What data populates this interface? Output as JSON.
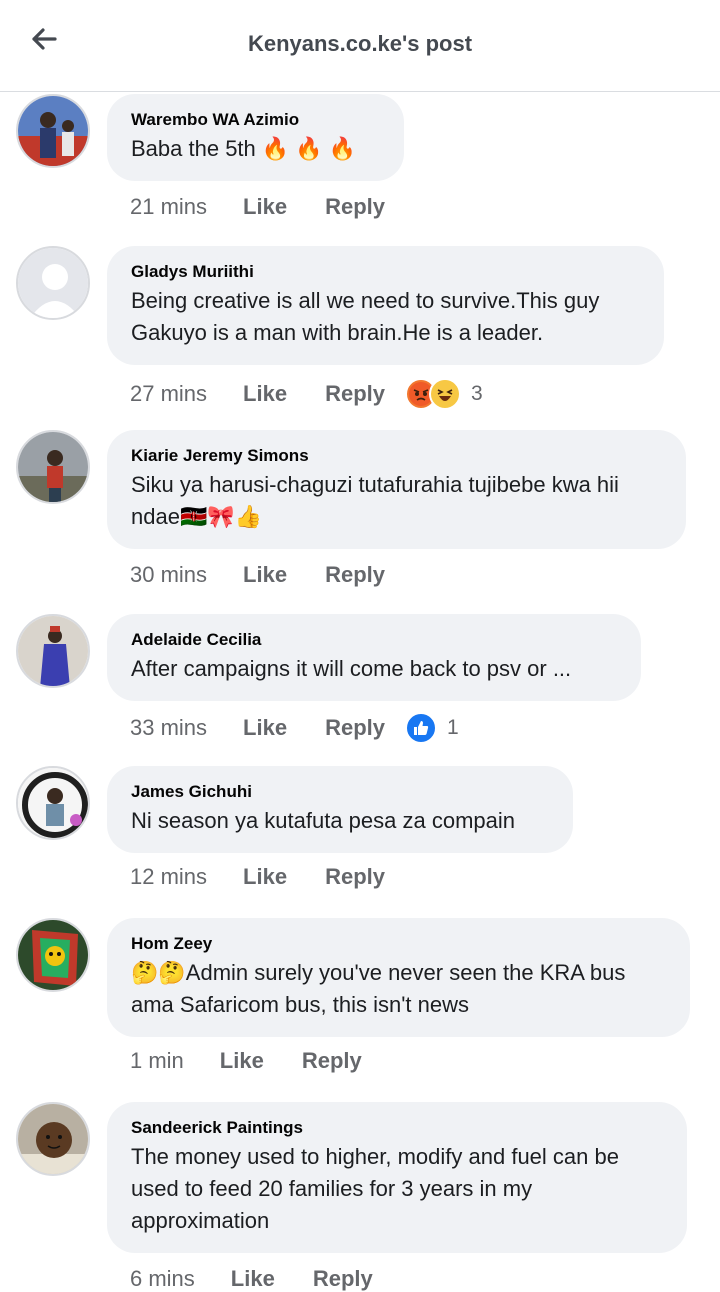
{
  "header": {
    "title": "Kenyans.co.ke's post"
  },
  "comments": [
    {
      "author": "Warembo WA Azimio",
      "text": "Baba the 5th 🔥 🔥 🔥",
      "time": "21 mins",
      "like": "Like",
      "reply": "Reply",
      "reaction_count": ""
    },
    {
      "author": "Gladys Muriithi",
      "text": "Being creative is all we need to survive.This guy Gakuyo is a man with brain.He is a leader.",
      "time": "27 mins",
      "like": "Like",
      "reply": "Reply",
      "reaction_count": "3"
    },
    {
      "author": "Kiarie Jeremy Simons",
      "text": "Siku ya harusi-chaguzi tutafurahia tujibebe kwa hii ndae🇰🇪🎀👍",
      "time": "30 mins",
      "like": "Like",
      "reply": "Reply",
      "reaction_count": ""
    },
    {
      "author": "Adelaide Cecilia",
      "text": "After campaigns it will come back to psv or ...",
      "time": "33 mins",
      "like": "Like",
      "reply": "Reply",
      "reaction_count": "1"
    },
    {
      "author": "James Gichuhi",
      "text": "Ni season ya kutafuta pesa za compain",
      "time": "12 mins",
      "like": "Like",
      "reply": "Reply",
      "reaction_count": ""
    },
    {
      "author": "Hom Zeey",
      "text": "🤔🤔Admin surely you've never seen the KRA bus ama Safaricom bus, this isn't news",
      "time": "1 min",
      "like": "Like",
      "reply": "Reply",
      "reaction_count": ""
    },
    {
      "author": "Sandeerick Paintings",
      "text": "The money used to higher, modify and fuel can be used to feed 20 families for 3 years in my approximation",
      "time": "6 mins",
      "like": "Like",
      "reply": "Reply",
      "reaction_count": ""
    }
  ]
}
